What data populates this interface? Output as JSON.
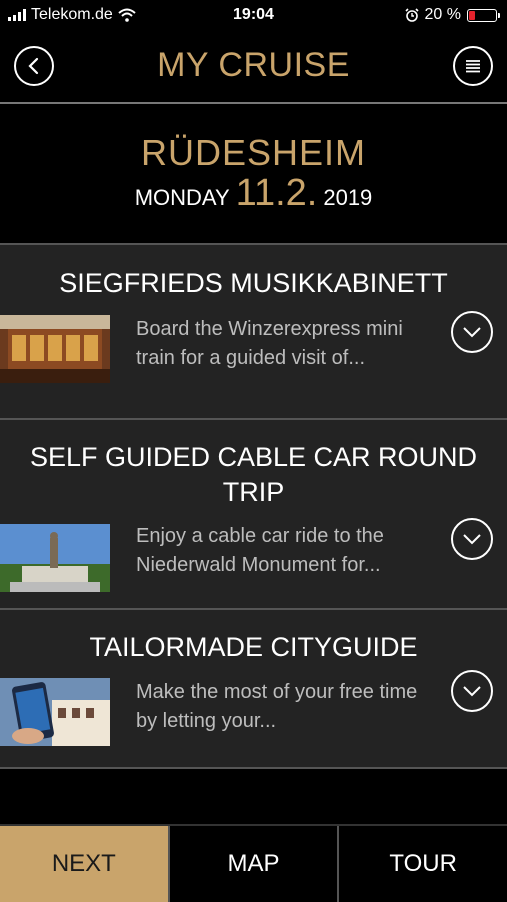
{
  "status_bar": {
    "carrier": "Telekom.de",
    "time": "19:04",
    "battery": "20 %",
    "battery_level": 0.2
  },
  "header": {
    "title": "MY CRUISE",
    "back_icon": "back-arrow-icon",
    "menu_icon": "hamburger-menu-icon"
  },
  "day": {
    "city": "RÜDESHEIM",
    "weekday": "MONDAY",
    "date": "11.2.",
    "year": "2019"
  },
  "excursions": [
    {
      "title": "SIEGFRIEDS MUSIKKABINETT",
      "description": "Board the Winzerexpress mini train for a guided visit of..."
    },
    {
      "title": "SELF GUIDED CABLE CAR ROUND TRIP",
      "description": "Enjoy a cable car ride to the Niederwald Monument for..."
    },
    {
      "title": "TAILORMADE CITYGUIDE",
      "description": "Make the most of your free time by letting your..."
    }
  ],
  "tabs": {
    "next": "NEXT",
    "map": "MAP",
    "tour": "TOUR"
  },
  "colors": {
    "accent": "#c9a46b",
    "background": "#000000",
    "card": "#232323",
    "battery_low": "#e5222c"
  }
}
